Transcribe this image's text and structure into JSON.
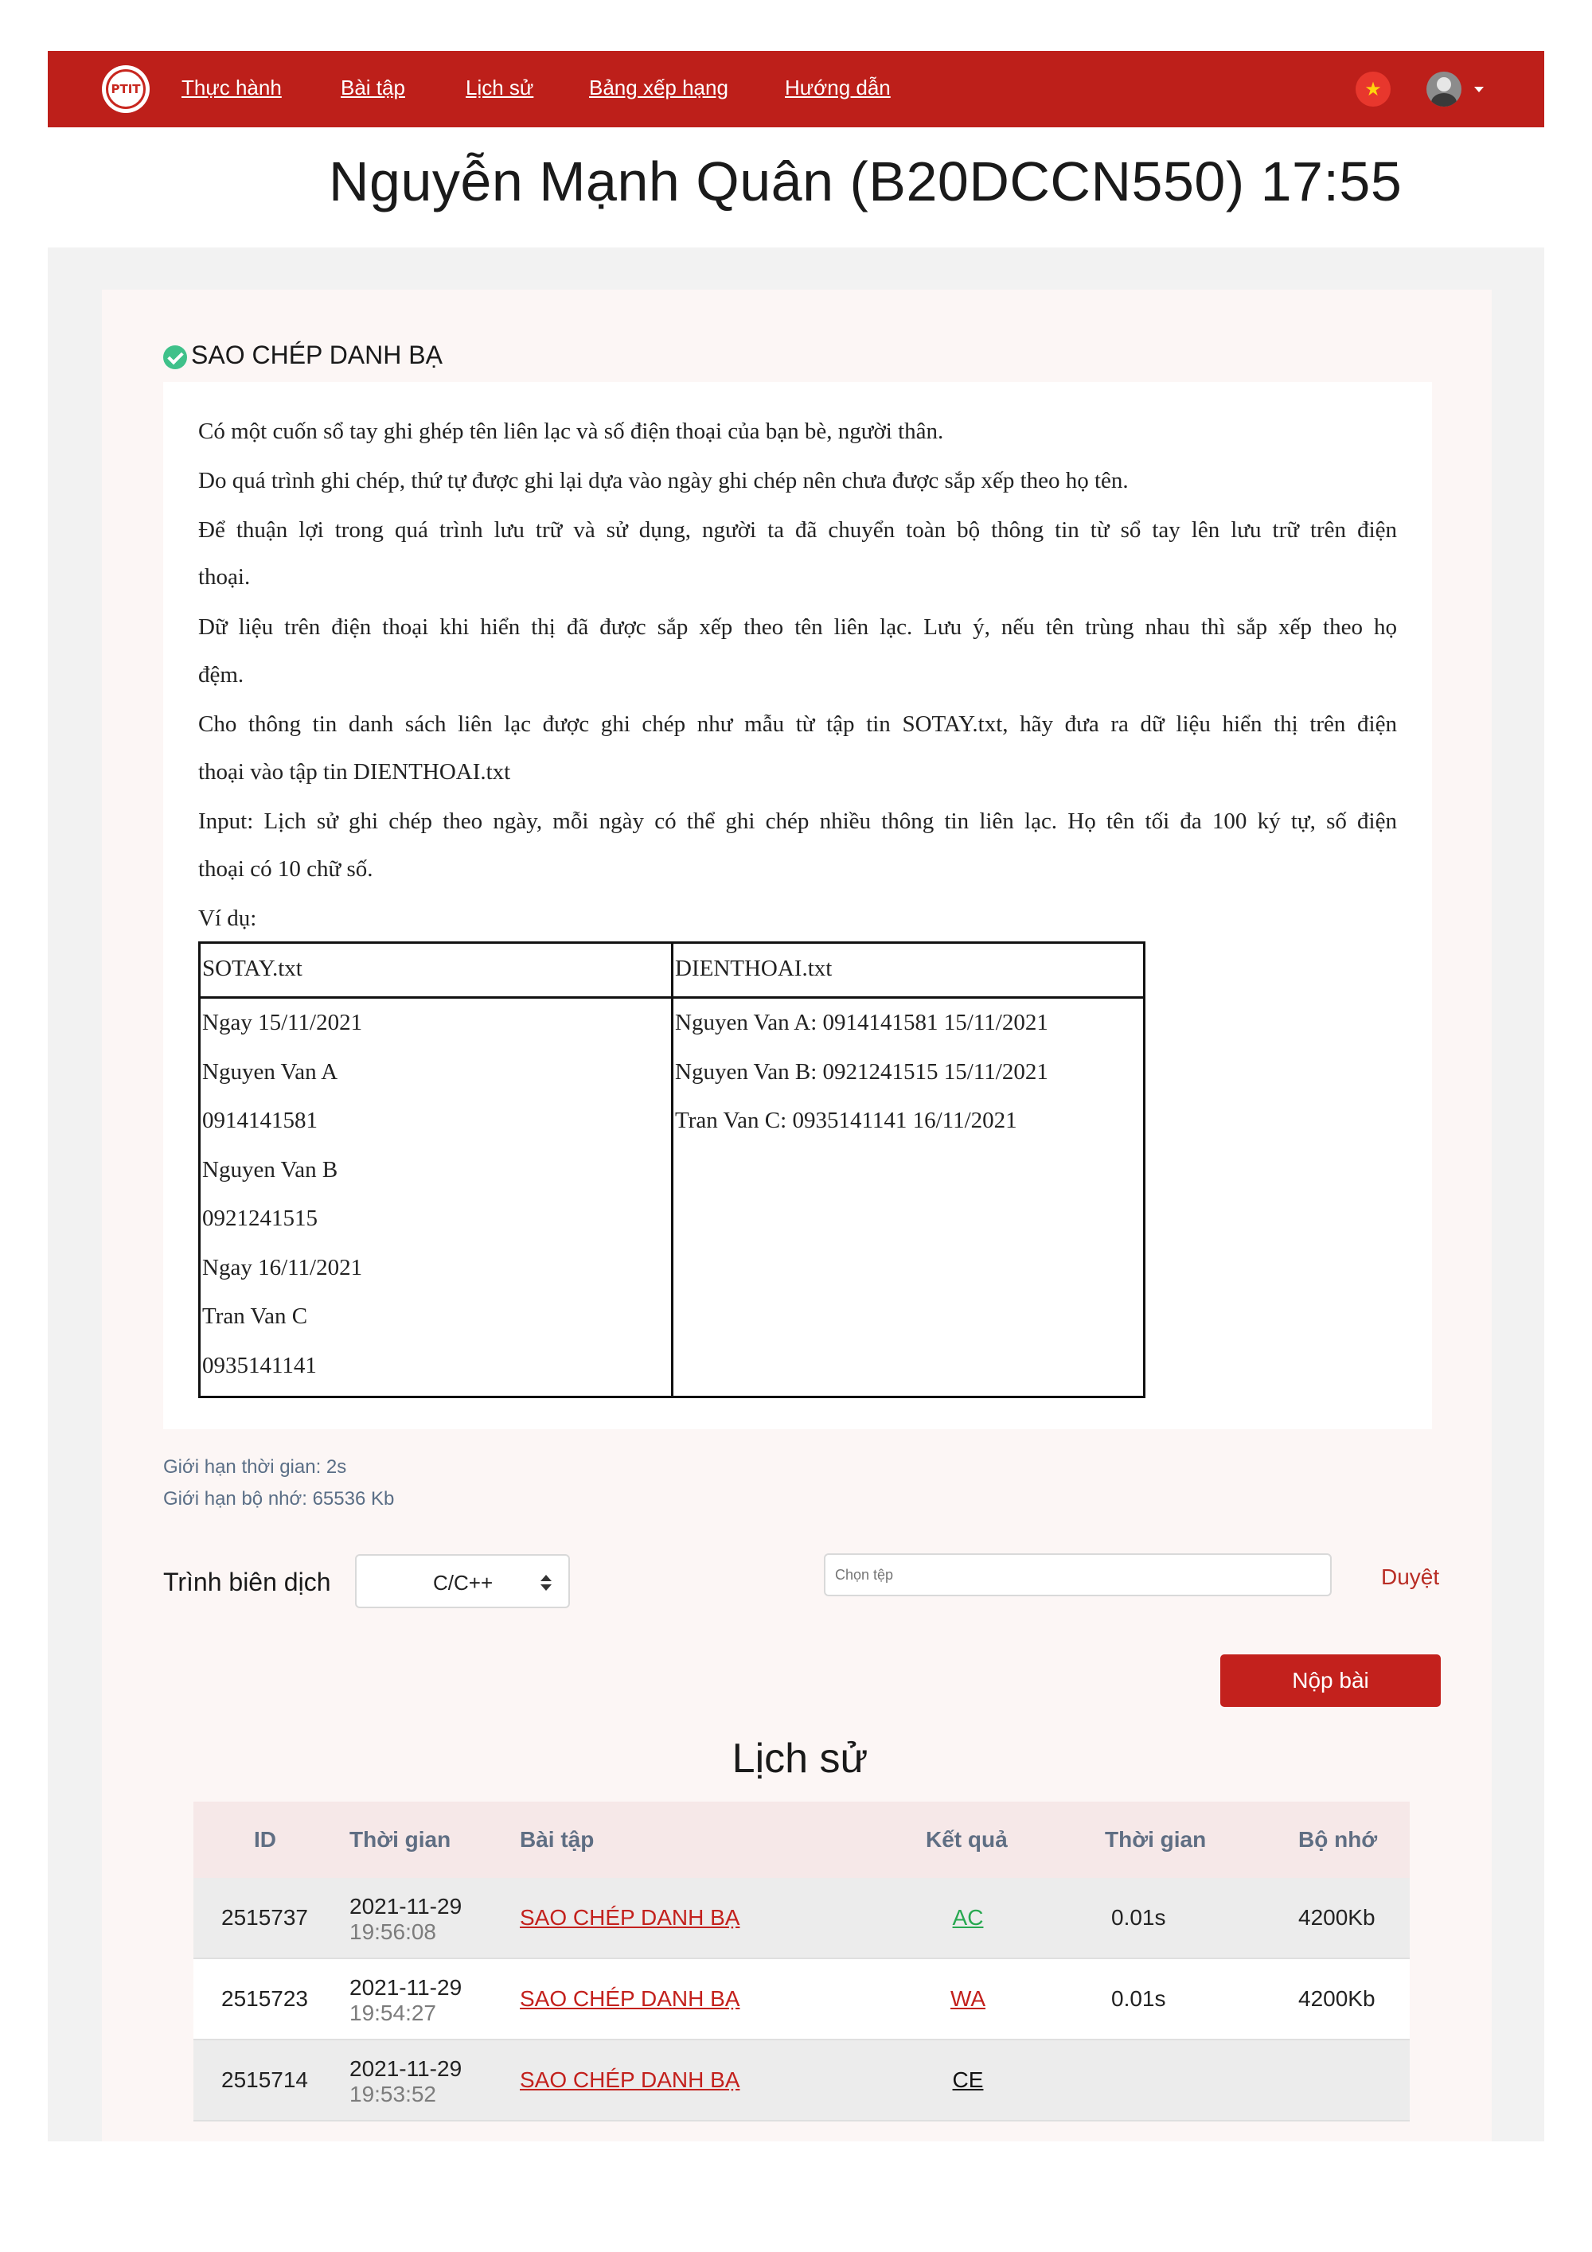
{
  "navbar": {
    "logo_text": "PTIT",
    "links": [
      "Thực hành",
      "Bài tập",
      "Lịch sử",
      "Bảng xếp hạng",
      "Hướng dẫn"
    ],
    "flag_icon": "vietnam-flag",
    "flag_glyph": "★"
  },
  "header": {
    "title": "Nguyễn Mạnh Quân (B20DCCN550)  17:55"
  },
  "problem": {
    "title": "SAO CHÉP DANH BẠ",
    "solved": true,
    "lines": [
      "Có một cuốn sổ tay ghi ghép tên liên lạc và số điện thoại của bạn bè, người thân.",
      "Do quá trình ghi chép, thứ tự được ghi lại dựa vào ngày ghi chép nên chưa được sắp xếp theo họ tên.",
      "Để thuận lợi trong quá trình lưu trữ và sử dụng, người ta đã chuyển toàn bộ thông tin từ sổ tay lên lưu trữ trên điện",
      "thoại.",
      "Dữ liệu trên điện thoại khi hiển thị đã được sắp xếp theo tên liên lạc. Lưu ý, nếu tên trùng nhau thì sắp xếp theo họ",
      "đệm.",
      "Cho thông tin danh sách liên lạc được ghi chép như mẫu từ tập tin SOTAY.txt, hãy đưa ra dữ liệu hiển thị trên điện",
      "thoại vào tập tin DIENTHOAI.txt",
      "Input: Lịch sử ghi chép theo ngày, mỗi ngày có thể ghi chép nhiều thông tin liên lạc. Họ tên tối đa 100 ký tự, số điện",
      "thoại có 10 chữ số.",
      "Ví dụ:"
    ],
    "example": {
      "headers": [
        "SOTAY.txt",
        "DIENTHOAI.txt"
      ],
      "input_lines": [
        "Ngay 15/11/2021",
        "Nguyen Van A",
        "0914141581",
        "Nguyen Van B",
        "0921241515",
        "Ngay 16/11/2021",
        "Tran Van C",
        "0935141141"
      ],
      "output_lines": [
        "Nguyen Van A: 0914141581 15/11/2021",
        "Nguyen Van B: 0921241515 15/11/2021",
        "Tran Van C: 0935141141 16/11/2021"
      ]
    },
    "time_limit": "Giới hạn thời gian: 2s",
    "memory_limit": "Giới hạn bộ nhớ: 65536 Kb"
  },
  "submit_form": {
    "compiler_label": "Trình biên dịch",
    "compiler_value": "C/C++",
    "file_placeholder": "Chọn tệp",
    "browse_label": "Duyệt",
    "submit_label": "Nộp bài"
  },
  "history": {
    "title": "Lịch sử",
    "columns": [
      "ID",
      "Thời gian",
      "Bài tập",
      "Kết quả",
      "Thời gian",
      "Bộ nhớ"
    ],
    "rows": [
      {
        "id": "2515737",
        "date": "2021-11-29",
        "time": "19:56:08",
        "task": "SAO CHÉP DANH BẠ",
        "result": "AC",
        "duration": "0.01s",
        "memory": "4200Kb"
      },
      {
        "id": "2515723",
        "date": "2021-11-29",
        "time": "19:54:27",
        "task": "SAO CHÉP DANH BẠ",
        "result": "WA",
        "duration": "0.01s",
        "memory": "4200Kb"
      },
      {
        "id": "2515714",
        "date": "2021-11-29",
        "time": "19:53:52",
        "task": "SAO CHÉP DANH BẠ",
        "result": "CE",
        "duration": "",
        "memory": ""
      }
    ]
  },
  "colors": {
    "brand": "#bd1f1a",
    "accepted": "#27a850",
    "wrong_answer": "#c3211d",
    "compile_error": "#111111"
  }
}
